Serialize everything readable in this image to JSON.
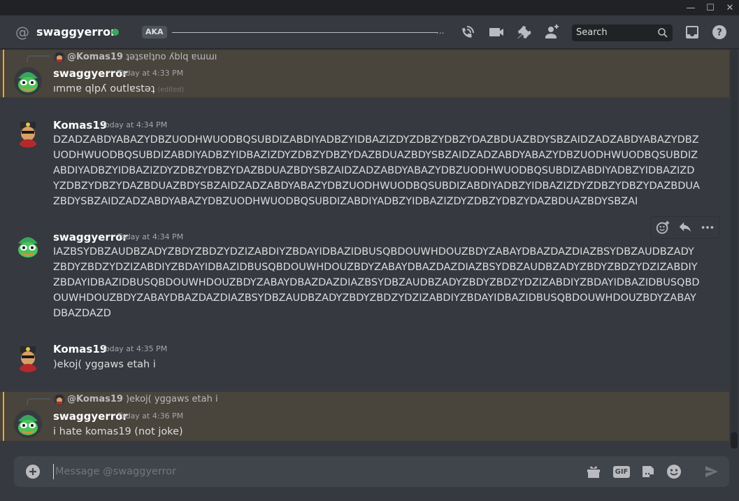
{
  "window": {
    "minimize": "—",
    "maximize": "☐",
    "close": "✕"
  },
  "header": {
    "channel_name": "swaggyerror",
    "aka_label": "AKA",
    "aka_ellipsis": "...",
    "search_placeholder": "Search"
  },
  "messages": [
    {
      "reply": {
        "user": "@Komas19",
        "text": "ʇǝʇsɐlʇno ʎblq ɐɯɯı"
      },
      "user": "swaggyerror",
      "timestamp": "Today at 4:33 PM",
      "text": "ımmɐ qlpʎ outlɐstǝʇ",
      "edited": "(edited)",
      "mention": true
    },
    {
      "user": "Komas19",
      "timestamp": "Today at 4:34 PM",
      "text": "DZADZABDYABAZYDBZUODHWUODBQSUBDIZABDIYADBZYIDBAZIZDYZDBZYDBZYDAZBDUAZBDYSBZAIDZADZABDYABAZYDBZUODHWUODBQSUBDIZABDIYADBZYIDBAZIZDYZDBZYDBZYDAZBDUAZBDYSBZAIDZADZABDYABAZYDBZUODHWUODBQSUBDIZABDIYADBZYIDBAZIZDYZDBZYDBZYDAZBDUAZBDYSBZAIDZADZABDYABAZYDBZUODHWUODBQSUBDIZABDIYADBZYIDBAZIZDYZDBZYDBZYDAZBDUAZBDYSBZAIDZADZABDYABAZYDBZUODHWUODBQSUBDIZABDIYADBZYIDBAZIZDYZDBZYDBZYDAZBDUAZBDYSBZAIDZADZABDYABAZYDBZUODHWUODBQSUBDIZABDIYADBZYIDBAZIZDYZDBZYDBZYDAZBDUAZBDYSBZAI"
    },
    {
      "user": "swaggyerror",
      "timestamp": "Today at 4:34 PM",
      "text": "IAZBSYDBZAUDBZADYZBDYZBDZYDZIZABDIYZBDAYIDBAZIDBUSQBDOUWHDOUZBDYZABAYDBAZDAZDIAZBSYDBZAUDBZADYZBDYZBDZYDZIZABDIYZBDAYIDBAZIDBUSQBDOUWHDOUZBDYZABAYDBAZDAZDIAZBSYDBZAUDBZADYZBDYZBDZYDZIZABDIYZBDAYIDBAZIDBUSQBDOUWHDOUZBDYZABAYDBAZDAZDIAZBSYDBZAUDBZADYZBDYZBDZYDZIZABDIYZBDAYIDBAZIDBUSQBDOUWHDOUZBDYZABAYDBAZDAZDIAZBSYDBZAUDBZADYZBDYZBDZYDZIZABDIYZBDAYIDBAZIDBUSQBDOUWHDOUZBDYZABAYDBAZDAZD"
    },
    {
      "user": "Komas19",
      "timestamp": "Today at 4:35 PM",
      "text": ")ekoj( yggaws etah i"
    },
    {
      "reply": {
        "user": "@Komas19",
        "text": ")ekoj( yggaws etah i"
      },
      "user": "swaggyerror",
      "timestamp": "Today at 4:36 PM",
      "text": "i hate komas19 (not joke)",
      "mention": true
    }
  ],
  "composer": {
    "placeholder": "Message @swaggyerror",
    "gif_label": "GIF"
  },
  "colors": {
    "accent_green": "#3ba55d",
    "mention_bar": "#faa81a",
    "background": "#36393f"
  }
}
